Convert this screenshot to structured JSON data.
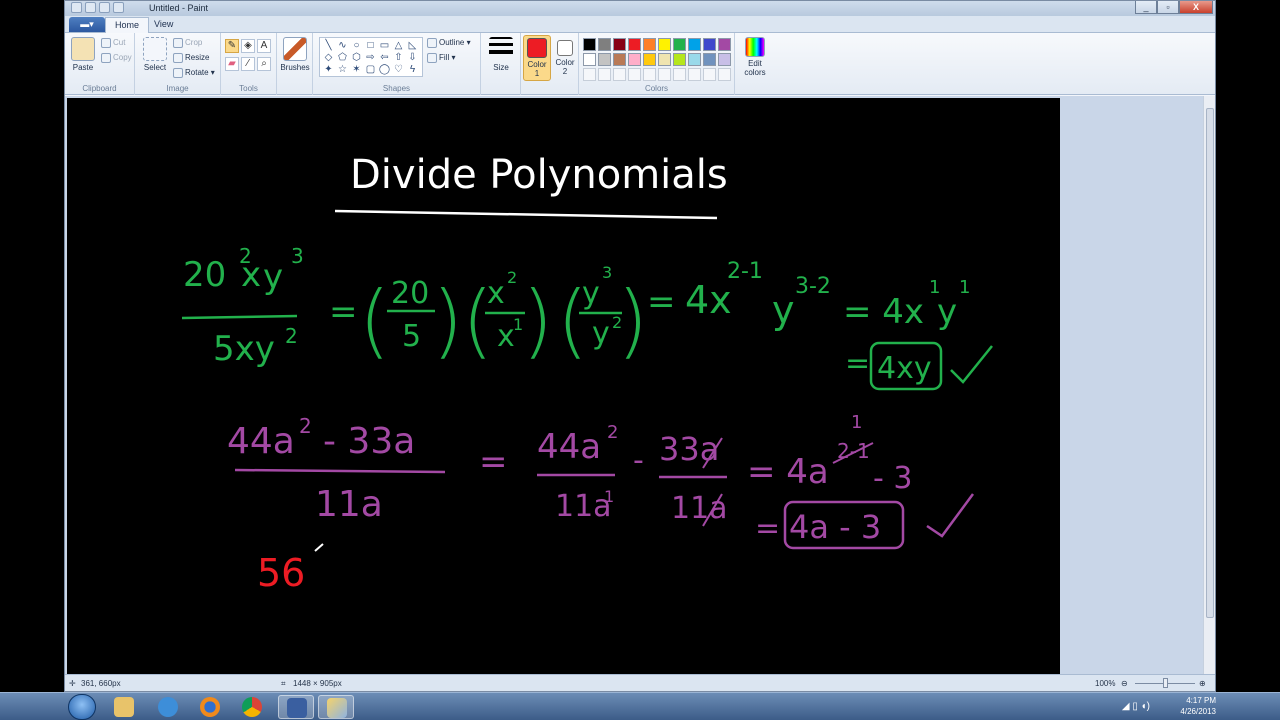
{
  "window": {
    "title": "Untitled - Paint",
    "controls": [
      "_",
      "▫",
      "X"
    ]
  },
  "menu": {
    "file_button": "▬▾"
  },
  "tabs": [
    {
      "label": "Home",
      "active": true
    },
    {
      "label": "View",
      "active": false
    }
  ],
  "ribbon": {
    "clipboard": {
      "paste": "Paste",
      "cut": "Cut",
      "copy": "Copy",
      "label": "Clipboard"
    },
    "image": {
      "select": "Select",
      "crop": "Crop",
      "resize": "Resize",
      "rotate": "Rotate",
      "label": "Image"
    },
    "tools": {
      "label": "Tools",
      "text_tool": "A"
    },
    "brushes": {
      "label": "Brushes"
    },
    "shapes": {
      "label": "Shapes",
      "outline": "Outline",
      "fill": "Fill",
      "glyphs": [
        "╲",
        "∿",
        "○",
        "□",
        "▭",
        "△",
        "◺",
        "◇",
        "⬠",
        "⬡",
        "⇨",
        "⇦",
        "⇧",
        "⇩",
        "✦",
        "☆",
        "✶",
        "▢",
        "◯",
        "♡",
        "ϟ"
      ]
    },
    "size": {
      "label": "Size"
    },
    "color1": {
      "label_line1": "Color",
      "label_line2": "1",
      "value": "#ed1c24"
    },
    "color2": {
      "label_line1": "Color",
      "label_line2": "2",
      "value": "#ffffff"
    },
    "colors": {
      "label": "Colors",
      "row1": [
        "#000000",
        "#7f7f7f",
        "#880015",
        "#ed1c24",
        "#ff7f27",
        "#fff200",
        "#22b14c",
        "#00a2e8",
        "#3f48cc",
        "#a349a4"
      ],
      "row2": [
        "#ffffff",
        "#c3c3c3",
        "#b97a57",
        "#ffaec9",
        "#ffc90e",
        "#efe4b0",
        "#b5e61d",
        "#99d9ea",
        "#7092be",
        "#c8bfe7"
      ]
    },
    "edit_colors": {
      "line1": "Edit",
      "line2": "colors"
    }
  },
  "canvas": {
    "title": "Divide Polynomials",
    "ink": {
      "white": "#ffffff",
      "green": "#22b14c",
      "purple": "#a349a4",
      "red": "#ed1c24"
    },
    "example1": {
      "num_coef": "20",
      "num_vars": "xy",
      "num_exp_x": "2",
      "num_exp_y": "3",
      "den": "5xy",
      "den_exp_y": "2",
      "eq": "=",
      "f1_num": "20",
      "f1_den": "5",
      "f2_num": "x",
      "f2_num_exp": "2",
      "f2_den": "x",
      "f2_den_exp": "1",
      "f3_num": "y",
      "f3_num_exp": "3",
      "f3_den": "y",
      "f3_den_exp": "2",
      "step2_coef": "4x",
      "step2_exp_x": "2-1",
      "step2_y": "y",
      "step2_exp_y": "3-2",
      "step3": "= 4x",
      "step3_exp_x": "1",
      "step3_y": "y",
      "step3_exp_y": "1",
      "answer_eq": "=",
      "answer": "4xy"
    },
    "example2": {
      "num_a": "44a",
      "num_a_exp": "2",
      "num_minus": "- 33a",
      "den": "11a",
      "eq": "=",
      "t1_num": "44a",
      "t1_num_exp": "2",
      "t1_den": "11a",
      "t1_den_exp": "1",
      "minus": "-",
      "t2_num": "33a",
      "t2_den": "11a",
      "step2": "= 4a",
      "step2_exp": "1",
      "step2_rest": "- 3",
      "answer_eq": "=",
      "answer": "4a - 3"
    },
    "example3": {
      "text": "56"
    }
  },
  "status": {
    "cursor_pos": "361, 660px",
    "image_size": "1448 × 905px",
    "zoom": "100%"
  },
  "taskbar": {
    "time": "4:17 PM",
    "date": "4/26/2013"
  }
}
